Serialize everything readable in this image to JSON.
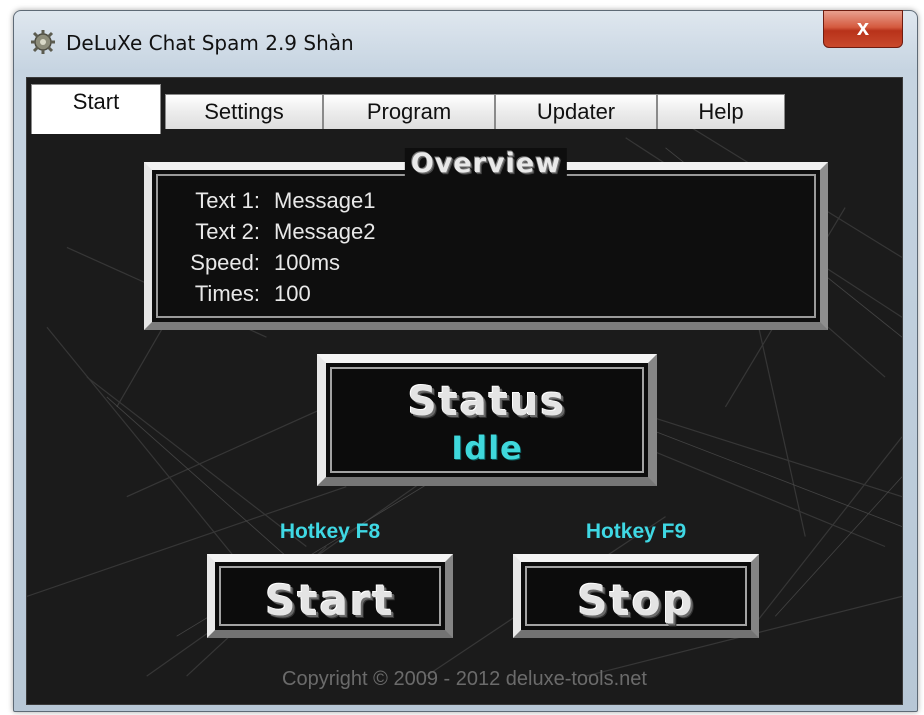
{
  "window": {
    "title": "DeLuXe Chat Spam 2.9 Shàn",
    "close_label": "x",
    "app_icon": "gear-icon"
  },
  "tabs": [
    {
      "label": "Start",
      "active": true
    },
    {
      "label": "Settings",
      "active": false
    },
    {
      "label": "Program",
      "active": false
    },
    {
      "label": "Updater",
      "active": false
    },
    {
      "label": "Help",
      "active": false
    }
  ],
  "overview": {
    "title": "Overview",
    "rows": [
      {
        "label": "Text 1:",
        "value": "Message1"
      },
      {
        "label": "Text 2:",
        "value": "Message2"
      },
      {
        "label": "Speed:",
        "value": "100ms"
      },
      {
        "label": "Times:",
        "value": "100"
      }
    ]
  },
  "status": {
    "title": "Status",
    "value": "Idle"
  },
  "controls": {
    "start_hotkey": "Hotkey F8",
    "stop_hotkey": "Hotkey F9",
    "start_label": "Start",
    "stop_label": "Stop"
  },
  "footer": {
    "copyright": "Copyright © 2009 - 2012 deluxe-tools.net"
  },
  "colors": {
    "accent_cyan": "#3fd8dc",
    "background": "#1b1b1b"
  }
}
